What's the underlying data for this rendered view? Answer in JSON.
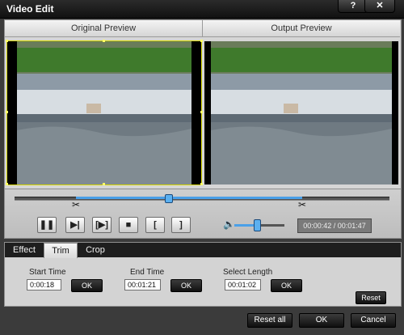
{
  "window": {
    "title": "Video Edit"
  },
  "titlebar": {
    "help_label": "?",
    "close_label": "✕"
  },
  "preview": {
    "original_label": "Original Preview",
    "output_label": "Output Preview"
  },
  "playback": {
    "play_pause_label": "❚❚",
    "next_frame_label": "▶|",
    "trim_frame_label": "[▶]",
    "stop_label": "■",
    "set_start_label": "[",
    "set_end_label": "]",
    "volume_icon": "🔈",
    "time_display": "00:00:42 / 00:01:47",
    "scissor_icon": "✂",
    "volume_level": 0.45,
    "position_fraction": 0.4
  },
  "edit": {
    "tabs": [
      {
        "label": "Effect"
      },
      {
        "label": "Trim"
      },
      {
        "label": "Crop"
      }
    ],
    "active_tab": "Trim",
    "start_time_label": "Start Time",
    "start_time_value": "0:00:18",
    "end_time_label": "End Time",
    "end_time_value": "00:01:21",
    "select_length_label": "Select Length",
    "select_length_value": "00:01:02",
    "ok_label": "OK",
    "reset_label": "Reset"
  },
  "footer": {
    "reset_all_label": "Reset all",
    "ok_label": "OK",
    "cancel_label": "Cancel"
  }
}
